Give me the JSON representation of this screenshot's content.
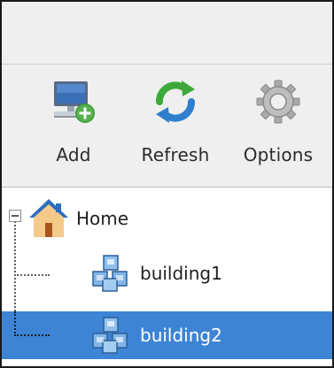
{
  "toolbar": {
    "add": {
      "label": "Add",
      "icon": "computer-add-icon"
    },
    "refresh": {
      "label": "Refresh",
      "icon": "refresh-icon"
    },
    "options": {
      "label": "Options",
      "icon": "gear-icon"
    }
  },
  "tree": {
    "root": {
      "label": "Home",
      "icon": "home-icon",
      "expanded": true
    },
    "children": [
      {
        "label": "building1",
        "icon": "building-icon",
        "selected": false
      },
      {
        "label": "building2",
        "icon": "building-icon",
        "selected": true
      }
    ]
  },
  "colors": {
    "selection": "#3d84d5",
    "chrome": "#efefef"
  }
}
